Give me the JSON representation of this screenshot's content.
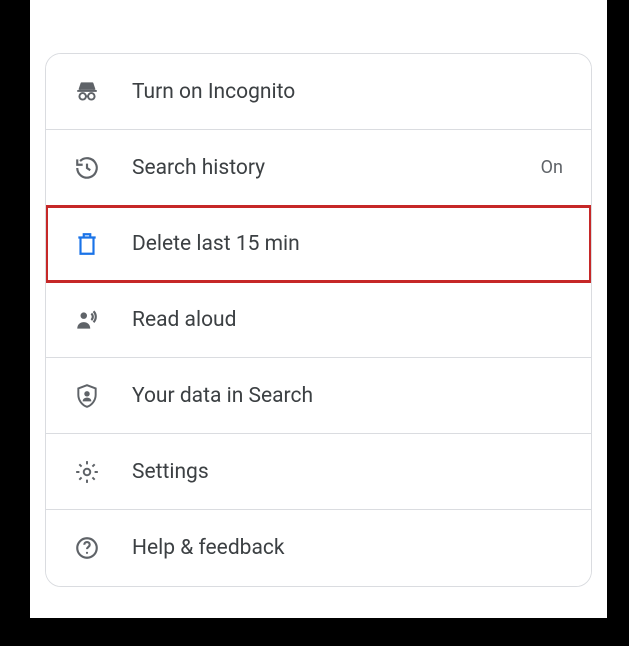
{
  "menu": {
    "items": [
      {
        "label": "Turn on Incognito",
        "icon": "incognito-icon",
        "trailing": "",
        "highlighted": false
      },
      {
        "label": "Search history",
        "icon": "history-icon",
        "trailing": "On",
        "highlighted": false
      },
      {
        "label": "Delete last 15 min",
        "icon": "trash-icon",
        "trailing": "",
        "highlighted": true
      },
      {
        "label": "Read aloud",
        "icon": "read-aloud-icon",
        "trailing": "",
        "highlighted": false
      },
      {
        "label": "Your data in Search",
        "icon": "data-shield-icon",
        "trailing": "",
        "highlighted": false
      },
      {
        "label": "Settings",
        "icon": "gear-icon",
        "trailing": "",
        "highlighted": false
      },
      {
        "label": "Help & feedback",
        "icon": "help-icon",
        "trailing": "",
        "highlighted": false
      }
    ]
  },
  "colors": {
    "highlight_outline": "#c62828",
    "trash_icon": "#1a73e8"
  }
}
